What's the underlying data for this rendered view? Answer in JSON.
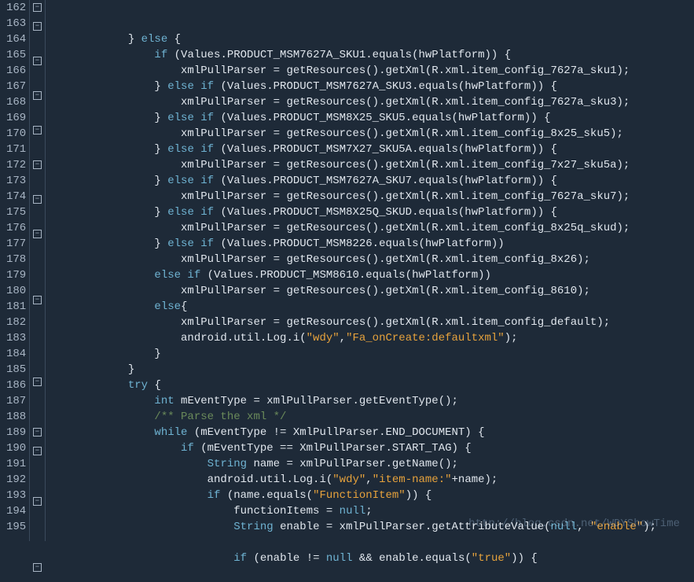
{
  "watermark": "http://blog.csdn.net/WDYShowTime",
  "lines": [
    {
      "num": 162,
      "fold": true,
      "indent": 12,
      "tokens": [
        {
          "t": "}"
        },
        {
          "t": " "
        },
        {
          "t": "else",
          "c": "kw"
        },
        {
          "t": " {"
        }
      ]
    },
    {
      "num": 163,
      "fold": true,
      "indent": 16,
      "tokens": [
        {
          "t": "if",
          "c": "kw"
        },
        {
          "t": " (Values.PRODUCT_MSM7627A_SKU1.equals(hwPlatform)) {"
        }
      ]
    },
    {
      "num": 164,
      "fold": false,
      "indent": 20,
      "tokens": [
        {
          "t": "xmlPullParser = getResources().getXml(R.xml.item_config_7627a_sku1);"
        }
      ]
    },
    {
      "num": 165,
      "fold": true,
      "indent": 16,
      "tokens": [
        {
          "t": "} "
        },
        {
          "t": "else if",
          "c": "kw"
        },
        {
          "t": " (Values.PRODUCT_MSM7627A_SKU3.equals(hwPlatform)) {"
        }
      ]
    },
    {
      "num": 166,
      "fold": false,
      "indent": 20,
      "tokens": [
        {
          "t": "xmlPullParser = getResources().getXml(R.xml.item_config_7627a_sku3);"
        }
      ]
    },
    {
      "num": 167,
      "fold": true,
      "indent": 16,
      "tokens": [
        {
          "t": "} "
        },
        {
          "t": "else if",
          "c": "kw"
        },
        {
          "t": " (Values.PRODUCT_MSM8X25_SKU5.equals(hwPlatform)) {"
        }
      ]
    },
    {
      "num": 168,
      "fold": false,
      "indent": 20,
      "tokens": [
        {
          "t": "xmlPullParser = getResources().getXml(R.xml.item_config_8x25_sku5);"
        }
      ]
    },
    {
      "num": 169,
      "fold": true,
      "indent": 16,
      "tokens": [
        {
          "t": "} "
        },
        {
          "t": "else if",
          "c": "kw"
        },
        {
          "t": " (Values.PRODUCT_MSM7X27_SKU5A.equals(hwPlatform)) {"
        }
      ]
    },
    {
      "num": 170,
      "fold": false,
      "indent": 20,
      "tokens": [
        {
          "t": "xmlPullParser = getResources().getXml(R.xml.item_config_7x27_sku5a);"
        }
      ]
    },
    {
      "num": 171,
      "fold": true,
      "indent": 16,
      "tokens": [
        {
          "t": "} "
        },
        {
          "t": "else if",
          "c": "kw"
        },
        {
          "t": " (Values.PRODUCT_MSM7627A_SKU7.equals(hwPlatform)) {"
        }
      ]
    },
    {
      "num": 172,
      "fold": false,
      "indent": 20,
      "tokens": [
        {
          "t": "xmlPullParser = getResources().getXml(R.xml.item_config_7627a_sku7);"
        }
      ]
    },
    {
      "num": 173,
      "fold": true,
      "indent": 16,
      "tokens": [
        {
          "t": "} "
        },
        {
          "t": "else if",
          "c": "kw"
        },
        {
          "t": " (Values.PRODUCT_MSM8X25Q_SKUD.equals(hwPlatform)) {"
        }
      ]
    },
    {
      "num": 174,
      "fold": false,
      "indent": 20,
      "tokens": [
        {
          "t": "xmlPullParser = getResources().getXml(R.xml.item_config_8x25q_skud);"
        }
      ]
    },
    {
      "num": 175,
      "fold": true,
      "indent": 16,
      "tokens": [
        {
          "t": "} "
        },
        {
          "t": "else if",
          "c": "kw"
        },
        {
          "t": " (Values.PRODUCT_MSM8226.equals(hwPlatform))"
        }
      ]
    },
    {
      "num": 176,
      "fold": false,
      "indent": 20,
      "tokens": [
        {
          "t": "xmlPullParser = getResources().getXml(R.xml.item_config_8x26);"
        }
      ]
    },
    {
      "num": 177,
      "fold": false,
      "indent": 16,
      "tokens": [
        {
          "t": "else if",
          "c": "kw"
        },
        {
          "t": " (Values.PRODUCT_MSM8610.equals(hwPlatform))"
        }
      ]
    },
    {
      "num": 178,
      "fold": false,
      "indent": 20,
      "tokens": [
        {
          "t": "xmlPullParser = getResources().getXml(R.xml.item_config_8610);"
        }
      ]
    },
    {
      "num": 179,
      "fold": true,
      "indent": 16,
      "tokens": [
        {
          "t": "else",
          "c": "kw"
        },
        {
          "t": "{"
        }
      ]
    },
    {
      "num": 180,
      "fold": false,
      "indent": 20,
      "tokens": [
        {
          "t": "xmlPullParser = getResources().getXml(R.xml.item_config_default);"
        }
      ]
    },
    {
      "num": 181,
      "fold": false,
      "indent": 20,
      "tokens": [
        {
          "t": "android.util.Log.i("
        },
        {
          "t": "\"wdy\"",
          "c": "str"
        },
        {
          "t": ","
        },
        {
          "t": "\"Fa_onCreate:defaultxml\"",
          "c": "str"
        },
        {
          "t": ");"
        }
      ]
    },
    {
      "num": 182,
      "fold": false,
      "indent": 16,
      "tokens": [
        {
          "t": "}"
        }
      ]
    },
    {
      "num": 183,
      "fold": false,
      "indent": 12,
      "tokens": [
        {
          "t": "}"
        }
      ]
    },
    {
      "num": 184,
      "fold": true,
      "indent": 12,
      "tokens": [
        {
          "t": "try",
          "c": "kw"
        },
        {
          "t": " {"
        }
      ]
    },
    {
      "num": 185,
      "fold": false,
      "indent": 16,
      "tokens": [
        {
          "t": "int",
          "c": "typ"
        },
        {
          "t": " mEventType = xmlPullParser.getEventType();"
        }
      ]
    },
    {
      "num": 186,
      "fold": false,
      "indent": 16,
      "tokens": [
        {
          "t": "/** Parse the xml */",
          "c": "cm"
        }
      ]
    },
    {
      "num": 187,
      "fold": true,
      "indent": 16,
      "tokens": [
        {
          "t": "while",
          "c": "kw"
        },
        {
          "t": " (mEventType != XmlPullParser.END_DOCUMENT) {"
        }
      ]
    },
    {
      "num": 188,
      "fold": true,
      "indent": 20,
      "tokens": [
        {
          "t": "if",
          "c": "kw"
        },
        {
          "t": " (mEventType == XmlPullParser.START_TAG) {"
        }
      ]
    },
    {
      "num": 189,
      "fold": false,
      "indent": 24,
      "tokens": [
        {
          "t": "String",
          "c": "typ"
        },
        {
          "t": " name = xmlPullParser.getName();"
        }
      ]
    },
    {
      "num": 190,
      "fold": false,
      "indent": 24,
      "tokens": [
        {
          "t": "android.util.Log.i("
        },
        {
          "t": "\"wdy\"",
          "c": "str"
        },
        {
          "t": ","
        },
        {
          "t": "\"item-name:\"",
          "c": "str"
        },
        {
          "t": "+name);"
        }
      ]
    },
    {
      "num": 191,
      "fold": true,
      "indent": 24,
      "tokens": [
        {
          "t": "if",
          "c": "kw"
        },
        {
          "t": " (name.equals("
        },
        {
          "t": "\"FunctionItem\"",
          "c": "str"
        },
        {
          "t": ")) {"
        }
      ]
    },
    {
      "num": 192,
      "fold": false,
      "indent": 28,
      "tokens": [
        {
          "t": "functionItems = "
        },
        {
          "t": "null",
          "c": "kw"
        },
        {
          "t": ";"
        }
      ]
    },
    {
      "num": 193,
      "fold": false,
      "indent": 28,
      "tokens": [
        {
          "t": "String",
          "c": "typ"
        },
        {
          "t": " enable = xmlPullParser.getAttributeValue("
        },
        {
          "t": "null",
          "c": "kw"
        },
        {
          "t": ", "
        },
        {
          "t": "\"enable\"",
          "c": "str"
        },
        {
          "t": ");"
        }
      ]
    },
    {
      "num": 194,
      "fold": false,
      "indent": 28,
      "tokens": []
    },
    {
      "num": 195,
      "fold": true,
      "indent": 28,
      "tokens": [
        {
          "t": "if",
          "c": "kw"
        },
        {
          "t": " (enable "
        },
        {
          "t": "!=",
          "c": "op"
        },
        {
          "t": " "
        },
        {
          "t": "null",
          "c": "kw"
        },
        {
          "t": " "
        },
        {
          "t": "&&",
          "c": "op"
        },
        {
          "t": " enable.equals("
        },
        {
          "t": "\"true\"",
          "c": "str"
        },
        {
          "t": ")) {"
        }
      ]
    }
  ]
}
